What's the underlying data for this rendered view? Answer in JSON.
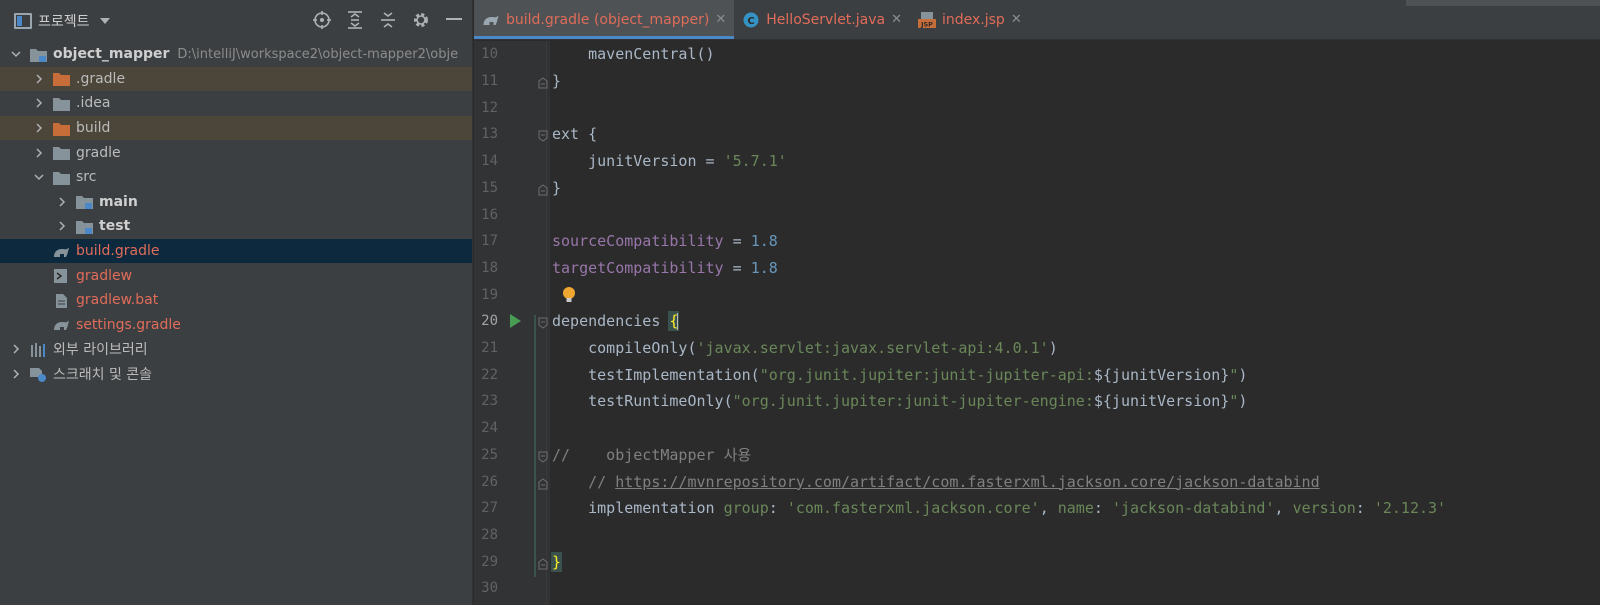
{
  "project_panel": {
    "title": "프로젝트",
    "tree": [
      {
        "label": "object_mapper",
        "path": "D:\\intelliJ\\workspace2\\object-mapper2\\obje",
        "bold": true,
        "expanded": true,
        "level": 0,
        "kind": "module"
      },
      {
        "label": ".gradle",
        "level": 1,
        "kind": "folder-orange",
        "collapsed": true
      },
      {
        "label": ".idea",
        "level": 1,
        "kind": "folder",
        "collapsed": true
      },
      {
        "label": "build",
        "level": 1,
        "kind": "folder-orange",
        "collapsed": true
      },
      {
        "label": "gradle",
        "level": 1,
        "kind": "folder",
        "collapsed": true
      },
      {
        "label": "src",
        "level": 1,
        "kind": "folder",
        "expanded": true
      },
      {
        "label": "main",
        "level": 2,
        "kind": "source-folder",
        "collapsed": true,
        "bold": true
      },
      {
        "label": "test",
        "level": 2,
        "kind": "source-folder",
        "collapsed": true,
        "bold": true
      },
      {
        "label": "build.gradle",
        "level": 1,
        "kind": "gradle-file",
        "selected": true
      },
      {
        "label": "gradlew",
        "level": 1,
        "kind": "script-file"
      },
      {
        "label": "gradlew.bat",
        "level": 1,
        "kind": "text-file"
      },
      {
        "label": "settings.gradle",
        "level": 1,
        "kind": "gradle-file"
      },
      {
        "label": "외부 라이브러리",
        "level": 0,
        "kind": "libraries",
        "collapsed": true
      },
      {
        "label": "스크래치 및 콘솔",
        "level": 0,
        "kind": "scratches",
        "collapsed": true
      }
    ]
  },
  "tabs": [
    {
      "label": "build.gradle (object_mapper)",
      "icon": "gradle-icon",
      "active": true
    },
    {
      "label": "HelloServlet.java",
      "icon": "java-class-icon",
      "active": false
    },
    {
      "label": "index.jsp",
      "icon": "jsp-icon",
      "active": false
    }
  ],
  "code_lines": [
    {
      "n": "10",
      "text": "    mavenCentral()"
    },
    {
      "n": "11",
      "text": "}"
    },
    {
      "n": "12",
      "text": ""
    },
    {
      "n": "13",
      "text": "ext {"
    },
    {
      "n": "14",
      "text": "    junitVersion = '5.7.1'"
    },
    {
      "n": "15",
      "text": "}"
    },
    {
      "n": "16",
      "text": ""
    },
    {
      "n": "17",
      "text": "sourceCompatibility = 1.8"
    },
    {
      "n": "18",
      "text": "targetCompatibility = 1.8"
    },
    {
      "n": "19",
      "text": ""
    },
    {
      "n": "20",
      "text": "dependencies {"
    },
    {
      "n": "21",
      "text": "    compileOnly('javax.servlet:javax.servlet-api:4.0.1')"
    },
    {
      "n": "22",
      "text": "    testImplementation(\"org.junit.jupiter:junit-jupiter-api:${junitVersion}\")"
    },
    {
      "n": "23",
      "text": "    testRuntimeOnly(\"org.junit.jupiter:junit-jupiter-engine:${junitVersion}\")"
    },
    {
      "n": "24",
      "text": ""
    },
    {
      "n": "25",
      "text": "//    objectMapper 사용"
    },
    {
      "n": "26",
      "text": "    // https://mvnrepository.com/artifact/com.fasterxml.jackson.core/jackson-databind"
    },
    {
      "n": "27",
      "text": "    implementation group: 'com.fasterxml.jackson.core', name: 'jackson-databind', version: '2.12.3'"
    },
    {
      "n": "28",
      "text": ""
    },
    {
      "n": "29",
      "text": "}"
    },
    {
      "n": "30",
      "text": ""
    }
  ],
  "colors": {
    "keyword": "#cc7832",
    "string": "#6a8759",
    "property": "#9876aa",
    "number": "#6897bb",
    "comment": "#808080",
    "vcs_modified": "#e06c5a",
    "selection": "#0d293e"
  }
}
